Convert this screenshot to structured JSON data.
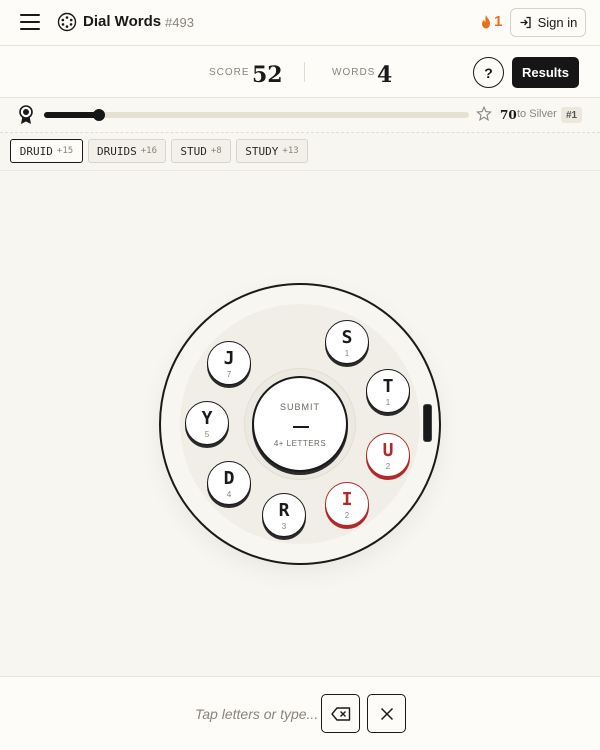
{
  "header": {
    "title": "Dial Words",
    "puzzle_number": "#493",
    "streak": "1",
    "signin_label": "Sign in"
  },
  "stats": {
    "score_label": "SCORE",
    "score": "52",
    "words_label": "WORDS",
    "words": "4",
    "help_label": "?",
    "results_label": "Results"
  },
  "progress": {
    "fraction": 0.13,
    "points_to_next": "70",
    "next_rank_text": "to Silver",
    "rank_badge": "#1"
  },
  "found_words": [
    {
      "word": "DRUID",
      "points": "+15",
      "active": true
    },
    {
      "word": "DRUIDS",
      "points": "+16",
      "active": false
    },
    {
      "word": "STUD",
      "points": "+8",
      "active": false
    },
    {
      "word": "STUDY",
      "points": "+13",
      "active": false
    }
  ],
  "dial": {
    "submit_label": "SUBMIT",
    "submit_hint": "4+ LETTERS",
    "tiles": [
      {
        "letter": "S",
        "value": "1",
        "used": false
      },
      {
        "letter": "T",
        "value": "1",
        "used": false
      },
      {
        "letter": "U",
        "value": "2",
        "used": true
      },
      {
        "letter": "I",
        "value": "2",
        "used": true
      },
      {
        "letter": "R",
        "value": "3",
        "used": false
      },
      {
        "letter": "D",
        "value": "4",
        "used": false
      },
      {
        "letter": "Y",
        "value": "5",
        "used": false
      },
      {
        "letter": "J",
        "value": "7",
        "used": false
      }
    ]
  },
  "input": {
    "placeholder": "Tap letters or type..."
  },
  "colors": {
    "accent_dark": "#161616",
    "used_red": "#b02a2a",
    "streak_orange": "#e8701a",
    "background": "#f8f6f1"
  },
  "icons": {
    "menu": "hamburger-icon",
    "logo": "dial-logo-icon",
    "streak": "flame-icon",
    "signin": "login-arrow-icon",
    "rank": "ribbon-medal-icon",
    "next_rank": "star-icon",
    "backspace": "backspace-icon",
    "clear": "close-icon"
  }
}
